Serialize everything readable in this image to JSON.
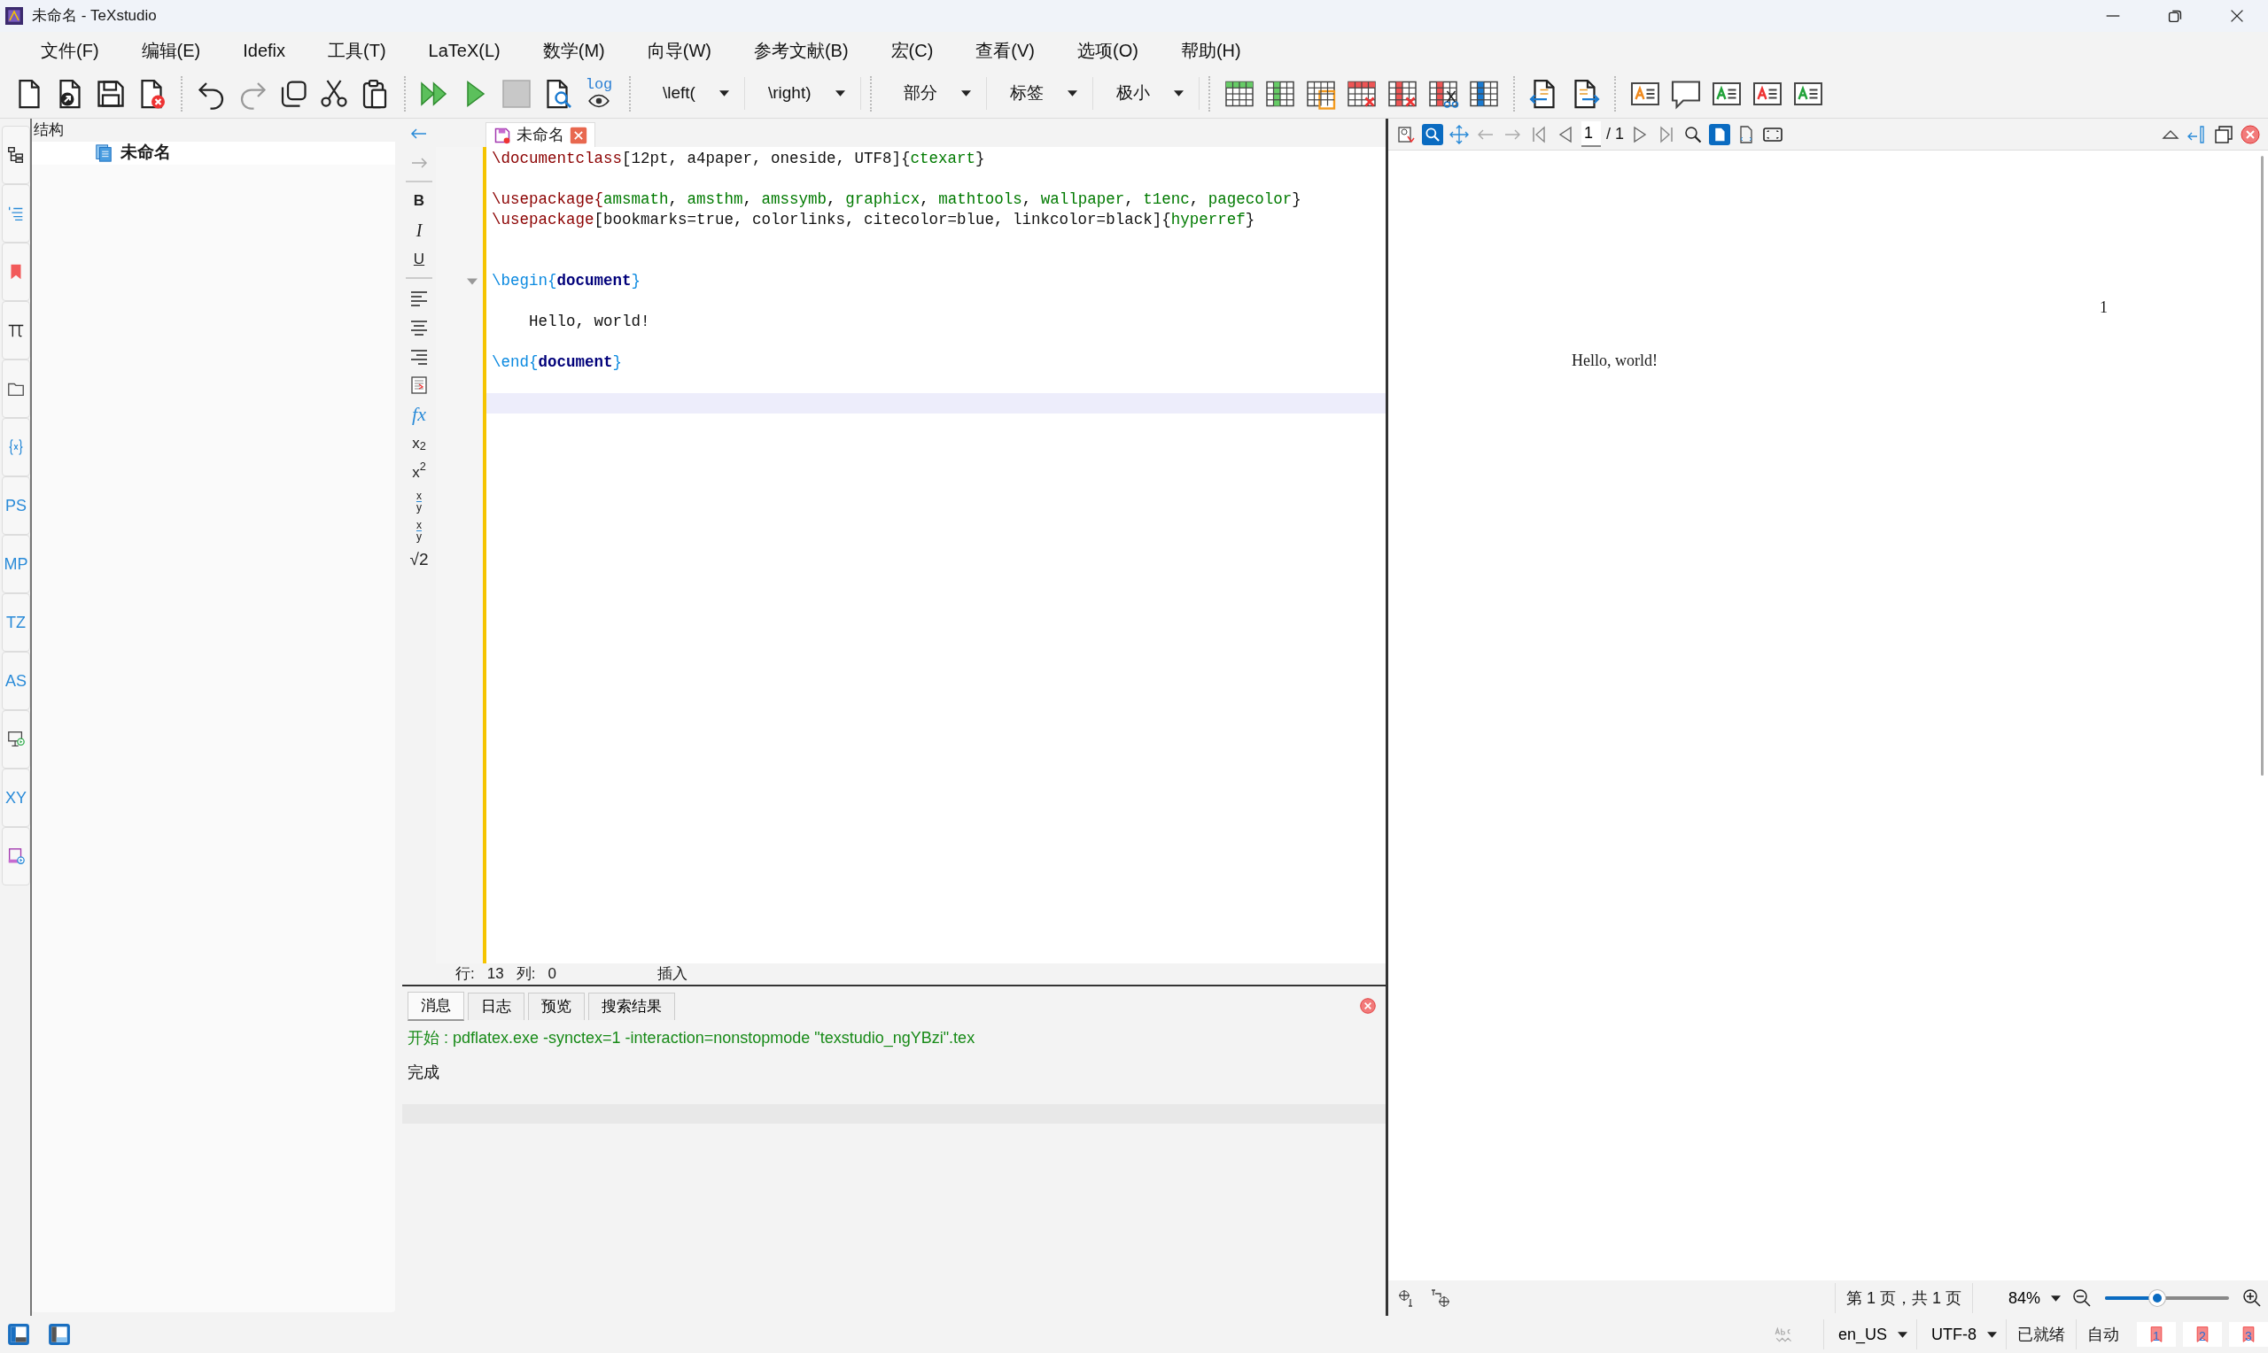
{
  "window": {
    "title": "未命名 - TeXstudio"
  },
  "menu": [
    "文件(F)",
    "编辑(E)",
    "Idefix",
    "工具(T)",
    "LaTeX(L)",
    "数学(M)",
    "向导(W)",
    "参考文献(B)",
    "宏(C)",
    "查看(V)",
    "选项(O)",
    "帮助(H)"
  ],
  "toolbar": {
    "log_label": "log",
    "dropdowns": [
      "\\left(",
      "\\right)",
      "部分",
      "标签",
      "极小"
    ]
  },
  "side_tabs": [
    {
      "kind": "icon"
    },
    {
      "kind": "icon"
    },
    {
      "kind": "icon"
    },
    {
      "kind": "icon"
    },
    {
      "kind": "icon"
    },
    {
      "kind": "icon"
    },
    {
      "kind": "text",
      "label": "PS"
    },
    {
      "kind": "text",
      "label": "MP"
    },
    {
      "kind": "text",
      "label": "TZ"
    },
    {
      "kind": "text",
      "label": "AS"
    },
    {
      "kind": "icon"
    },
    {
      "kind": "text",
      "label": "XY"
    },
    {
      "kind": "icon"
    }
  ],
  "structure": {
    "title": "结构",
    "items": [
      {
        "label": "未命名"
      }
    ]
  },
  "math_toolbar": [
    {
      "kind": "icon"
    },
    {
      "kind": "icon"
    },
    {
      "kind": "bold",
      "label": "B"
    },
    {
      "kind": "italic",
      "label": "I"
    },
    {
      "kind": "underline",
      "label": "U"
    },
    {
      "kind": "icon"
    },
    {
      "kind": "icon"
    },
    {
      "kind": "icon"
    },
    {
      "kind": "icon"
    },
    {
      "kind": "function",
      "label": "fx"
    },
    {
      "kind": "script",
      "label": "x$_{2}$"
    },
    {
      "kind": "script",
      "label": "x$^{2}$"
    },
    {
      "kind": "frac",
      "num": "x",
      "den": "y"
    },
    {
      "kind": "frac",
      "num": "x",
      "den": "y"
    },
    {
      "kind": "root",
      "label": "√2"
    }
  ],
  "editor": {
    "tab": {
      "label": "未命名"
    },
    "lines": [
      {
        "kind": "code",
        "tokens": [
          {
            "text": "\\documentclass",
            "kind": "command"
          },
          {
            "text": "[12pt, a4paper, oneside, UTF8]{",
            "kind": "plain"
          },
          {
            "text": "ctexart",
            "kind": "argument"
          },
          {
            "text": "}",
            "kind": "plain"
          }
        ]
      },
      {
        "kind": "blank"
      },
      {
        "kind": "code",
        "tokens": [
          {
            "text": "\\usepackage{",
            "kind": "command"
          },
          {
            "text": "amsmath",
            "kind": "argument"
          },
          {
            "text": ", ",
            "kind": "plain"
          },
          {
            "text": "amsthm",
            "kind": "argument"
          },
          {
            "text": ", ",
            "kind": "plain"
          },
          {
            "text": "amssymb",
            "kind": "argument"
          },
          {
            "text": ", ",
            "kind": "plain"
          },
          {
            "text": "graphicx",
            "kind": "argument"
          },
          {
            "text": ", ",
            "kind": "plain"
          },
          {
            "text": "mathtools",
            "kind": "argument"
          },
          {
            "text": ", ",
            "kind": "plain"
          },
          {
            "text": "wallpaper",
            "kind": "argument"
          },
          {
            "text": ", ",
            "kind": "plain"
          },
          {
            "text": "t1enc",
            "kind": "argument"
          },
          {
            "text": ", ",
            "kind": "plain"
          },
          {
            "text": "pagecolor",
            "kind": "argument"
          },
          {
            "text": "}",
            "kind": "plain"
          }
        ]
      },
      {
        "kind": "code",
        "tokens": [
          {
            "text": "\\usepackage",
            "kind": "command"
          },
          {
            "text": "[bookmarks=true, colorlinks, citecolor=blue, linkcolor=black]{",
            "kind": "plain"
          },
          {
            "text": "hyperref",
            "kind": "argument"
          },
          {
            "text": "}",
            "kind": "plain"
          }
        ]
      },
      {
        "kind": "blank"
      },
      {
        "kind": "blank"
      },
      {
        "kind": "fold",
        "tokens": [
          {
            "text": "\\begin{",
            "kind": "environment"
          },
          {
            "text": "document",
            "kind": "env_name"
          },
          {
            "text": "}",
            "kind": "environment"
          }
        ]
      },
      {
        "kind": "blank"
      },
      {
        "kind": "code",
        "tokens": [
          {
            "text": "    Hello, world!",
            "kind": "plain"
          }
        ]
      },
      {
        "kind": "blank"
      },
      {
        "kind": "code",
        "tokens": [
          {
            "text": "\\end{",
            "kind": "environment"
          },
          {
            "text": "document",
            "kind": "env_name"
          },
          {
            "text": "}",
            "kind": "environment"
          }
        ]
      },
      {
        "kind": "blank"
      },
      {
        "kind": "current"
      }
    ]
  },
  "cursor_status": {
    "line_label": "行:",
    "line": "13",
    "col_label": "列:",
    "col": "0",
    "mode": "插入"
  },
  "messages": {
    "tabs": [
      {
        "label": "消息",
        "selected": true
      },
      {
        "label": "日志",
        "selected": false
      },
      {
        "label": "预览",
        "selected": false
      },
      {
        "label": "搜索结果",
        "selected": false
      }
    ],
    "lines": [
      {
        "kind": "command",
        "text": "开始 : pdflatex.exe -synctex=1 -interaction=nonstopmode \"texstudio_ngYBzi\".tex"
      },
      {
        "kind": "plain",
        "text": "完成"
      }
    ]
  },
  "viewer": {
    "magnifier_tool": {
      "selected": true
    },
    "fit_page": {
      "selected": true
    },
    "page_field": "1",
    "page_total": "/ 1",
    "page": {
      "number": "1",
      "body": "Hello, world!"
    },
    "page_info": "第 1 页，共 1 页",
    "zoom": "84%",
    "zoom_slider": {
      "level": 0.42
    }
  },
  "status_bar": {
    "language": "en_US",
    "encoding": "UTF-8",
    "state": "已就绪",
    "mode": "自动",
    "bookmarks": [
      "1",
      "2",
      "3"
    ]
  }
}
